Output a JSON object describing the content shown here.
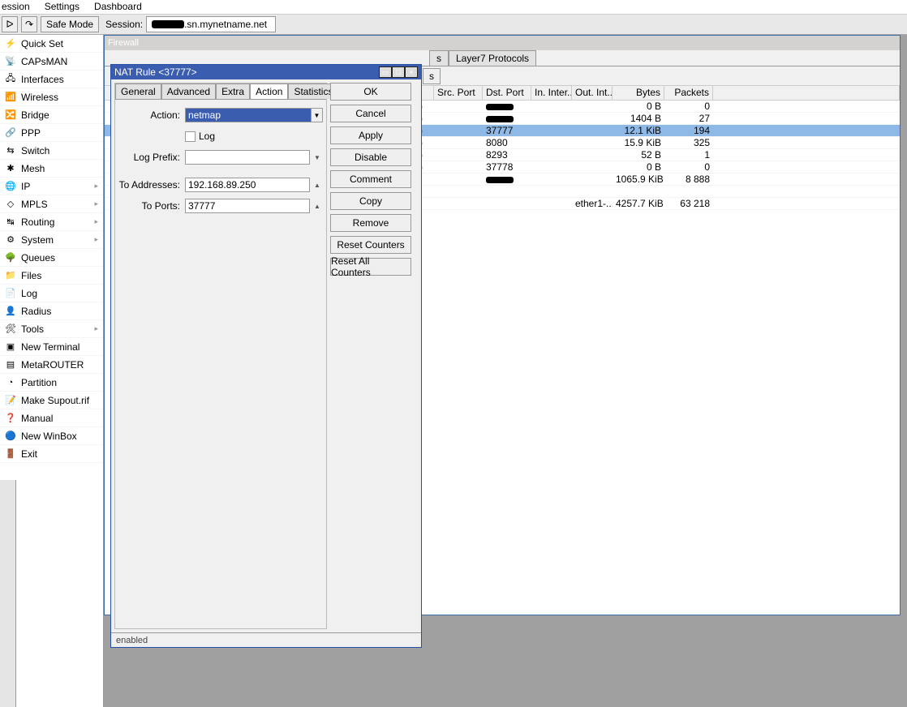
{
  "menubar": [
    "ession",
    "Settings",
    "Dashboard"
  ],
  "toolbar": {
    "safe_mode": "Safe Mode",
    "session_label": "Session:",
    "session_host": ".sn.mynetname.net"
  },
  "sidebar": {
    "items": [
      {
        "icon": "⚡",
        "label": "Quick Set"
      },
      {
        "icon": "📡",
        "label": "CAPsMAN"
      },
      {
        "icon": "🖧",
        "label": "Interfaces"
      },
      {
        "icon": "📶",
        "label": "Wireless"
      },
      {
        "icon": "🔀",
        "label": "Bridge"
      },
      {
        "icon": "🔗",
        "label": "PPP"
      },
      {
        "icon": "⇆",
        "label": "Switch"
      },
      {
        "icon": "✱",
        "label": "Mesh"
      },
      {
        "icon": "🌐",
        "label": "IP",
        "child": true
      },
      {
        "icon": "◇",
        "label": "MPLS",
        "child": true
      },
      {
        "icon": "↹",
        "label": "Routing",
        "child": true
      },
      {
        "icon": "⚙",
        "label": "System",
        "child": true
      },
      {
        "icon": "🌳",
        "label": "Queues"
      },
      {
        "icon": "📁",
        "label": "Files"
      },
      {
        "icon": "📄",
        "label": "Log"
      },
      {
        "icon": "👤",
        "label": "Radius"
      },
      {
        "icon": "🛠",
        "label": "Tools",
        "child": true
      },
      {
        "icon": "▣",
        "label": "New Terminal"
      },
      {
        "icon": "▤",
        "label": "MetaROUTER"
      },
      {
        "icon": "◔",
        "label": "Partition"
      },
      {
        "icon": "📝",
        "label": "Make Supout.rif"
      },
      {
        "icon": "❓",
        "label": "Manual"
      },
      {
        "icon": "🔵",
        "label": "New WinBox"
      },
      {
        "icon": "🚪",
        "label": "Exit"
      }
    ]
  },
  "firewall": {
    "title": "Firewall",
    "tabs": [
      "s",
      "Layer7 Protocols"
    ],
    "subbtns": [
      "s"
    ],
    "columns": {
      "srcport": "Src. Port",
      "dstport": "Dst. Port",
      "inint": "In. Inter...",
      "outint": "Out. Int...",
      "bytes": "Bytes",
      "packets": "Packets"
    },
    "rows": [
      {
        "p": ")",
        "dst": "",
        "bytes": "0 B",
        "packets": "0",
        "cov": true
      },
      {
        "p": ")",
        "dst": "",
        "bytes": "1404 B",
        "packets": "27",
        "cov": true
      },
      {
        "p": ")",
        "dst": "37777",
        "bytes": "12.1 KiB",
        "packets": "194",
        "sel": true
      },
      {
        "p": ")",
        "dst": "8080",
        "bytes": "15.9 KiB",
        "packets": "325"
      },
      {
        "p": ")",
        "dst": "8293",
        "bytes": "52 B",
        "packets": "1"
      },
      {
        "p": ")",
        "dst": "37778",
        "bytes": "0 B",
        "packets": "0"
      },
      {
        "p": "",
        "dst": "",
        "outint": "",
        "bytes": "1065.9 KiB",
        "packets": "8 888",
        "cov": true
      },
      {
        "p": "",
        "dst": "",
        "bytes": "",
        "packets": ""
      },
      {
        "p": "",
        "dst": "",
        "outint": "ether1-...",
        "bytes": "4257.7 KiB",
        "packets": "63 218"
      }
    ]
  },
  "dialog": {
    "title": "NAT Rule <37777>",
    "tabs": [
      "General",
      "Advanced",
      "Extra",
      "Action",
      "Statistics"
    ],
    "active_tab": 3,
    "form": {
      "action_label": "Action:",
      "action_value": "netmap",
      "log_label": "Log",
      "logprefix_label": "Log Prefix:",
      "logprefix_value": "",
      "toaddr_label": "To Addresses:",
      "toaddr_value": "192.168.89.250",
      "toports_label": "To Ports:",
      "toports_value": "37777"
    },
    "buttons": [
      "OK",
      "Cancel",
      "Apply",
      "Disable",
      "Comment",
      "Copy",
      "Remove",
      "Reset Counters",
      "Reset All Counters"
    ],
    "status": "enabled"
  }
}
